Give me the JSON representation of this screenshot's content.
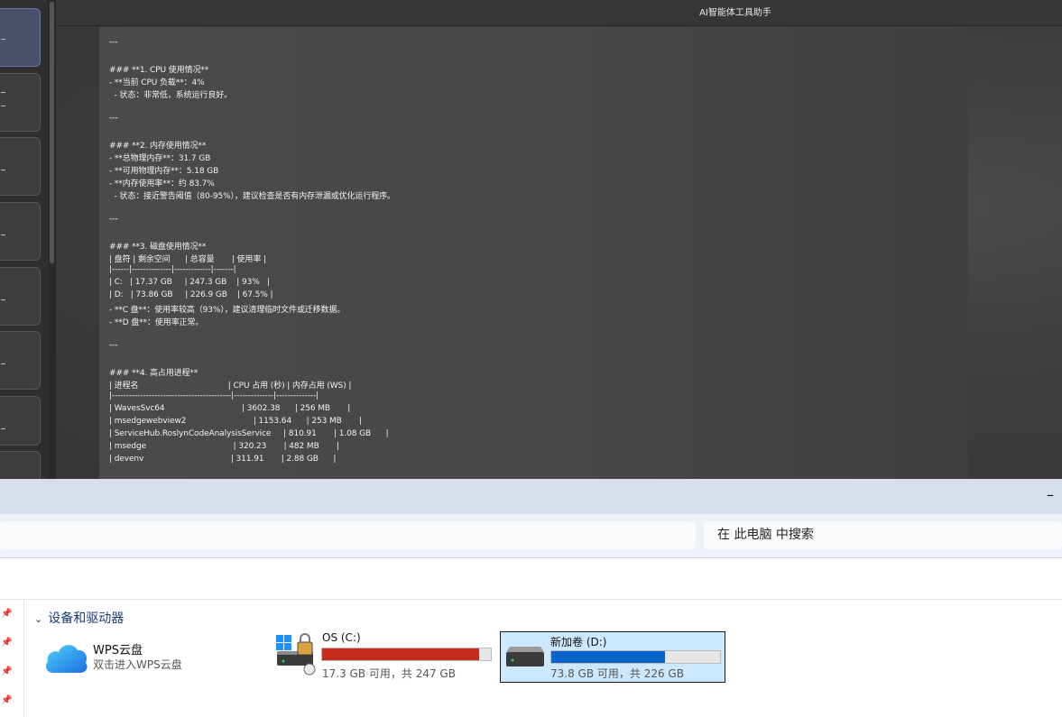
{
  "ai_window": {
    "title": "AI智能体工具助手",
    "report_lines": [
      "---",
      "### **1. CPU 使用情况**",
      "- **当前 CPU 负载**：4%",
      "  - 状态：非常低，系统运行良好。",
      "---",
      "### **2. 内存使用情况**",
      "- **总物理内存**：31.7 GB",
      "- **可用物理内存**：5.18 GB",
      "- **内存使用率**：约 83.7%",
      "  - 状态：接近警告阈值（80-95%），建议检查是否有内存泄漏或优化运行程序。",
      "---",
      "### **3. 磁盘使用情况**",
      "| 盘符 | 剩余空间      | 总容量       | 使用率 |",
      "|------|--------------|-------------|-------|",
      "| C:   | 17.37 GB     | 247.3 GB    | 93%   |",
      "| D:   | 73.86 GB     | 226.9 GB    | 67.5% |",
      "- **C 盘**：使用率较高（93%），建议清理临时文件或迁移数据。",
      "- **D 盘**：使用率正常。",
      "---",
      "### **4. 高占用进程**",
      "| 进程名                                    | CPU 占用 (秒) | 内存占用 (WS) |",
      "|------------------------------------------|--------------|--------------|",
      "| WavesSvc64                               | 3602.38      | 256 MB       |",
      "| msedgewebview2                           | 1153.64      | 253 MB       |",
      "| ServiceHub.RoslynCodeAnalysisService     | 810.91       | 1.08 GB      |",
      "| msedge                                   | 320.23       | 482 MB       |",
      "| devenv                                   | 311.91       | 2.88 GB      |"
    ]
  },
  "explorer": {
    "minimize_glyph": "–",
    "search_placeholder": "在 此电脑 中搜索",
    "section_title": "设备和驱动器",
    "wps": {
      "name": "WPS云盘",
      "description": "双击进入WPS云盘"
    },
    "drives": [
      {
        "name": "OS (C:)",
        "info": "17.3 GB 可用，共 247 GB",
        "used_fraction": 0.93,
        "bar_color": "#c42b1c",
        "selected": false
      },
      {
        "name": "新加卷 (D:)",
        "info": "73.8 GB 可用，共 226 GB",
        "used_fraction": 0.673,
        "bar_color": "#0a63c9",
        "selected": true
      }
    ]
  }
}
